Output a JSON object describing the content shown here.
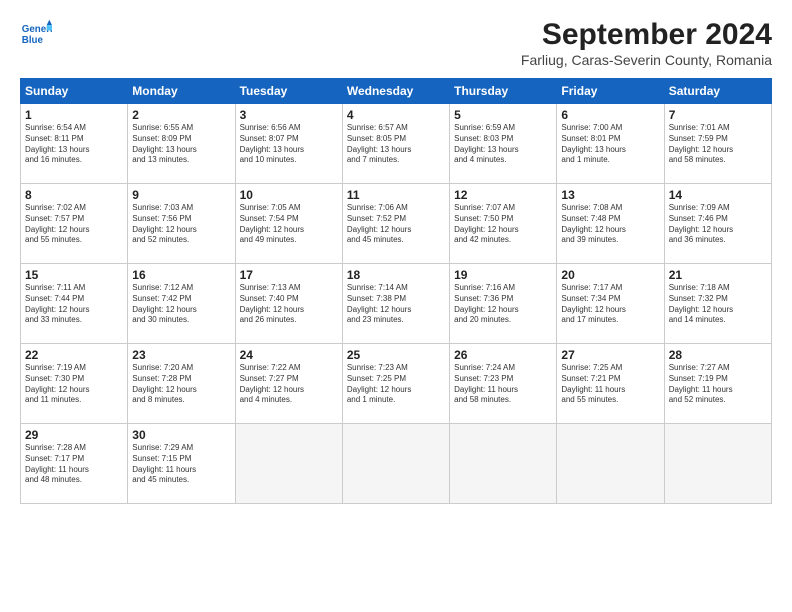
{
  "header": {
    "logo_line1": "General",
    "logo_line2": "Blue",
    "month": "September 2024",
    "location": "Farliug, Caras-Severin County, Romania"
  },
  "weekdays": [
    "Sunday",
    "Monday",
    "Tuesday",
    "Wednesday",
    "Thursday",
    "Friday",
    "Saturday"
  ],
  "weeks": [
    [
      {
        "day": "1",
        "info": "Sunrise: 6:54 AM\nSunset: 8:11 PM\nDaylight: 13 hours\nand 16 minutes."
      },
      {
        "day": "2",
        "info": "Sunrise: 6:55 AM\nSunset: 8:09 PM\nDaylight: 13 hours\nand 13 minutes."
      },
      {
        "day": "3",
        "info": "Sunrise: 6:56 AM\nSunset: 8:07 PM\nDaylight: 13 hours\nand 10 minutes."
      },
      {
        "day": "4",
        "info": "Sunrise: 6:57 AM\nSunset: 8:05 PM\nDaylight: 13 hours\nand 7 minutes."
      },
      {
        "day": "5",
        "info": "Sunrise: 6:59 AM\nSunset: 8:03 PM\nDaylight: 13 hours\nand 4 minutes."
      },
      {
        "day": "6",
        "info": "Sunrise: 7:00 AM\nSunset: 8:01 PM\nDaylight: 13 hours\nand 1 minute."
      },
      {
        "day": "7",
        "info": "Sunrise: 7:01 AM\nSunset: 7:59 PM\nDaylight: 12 hours\nand 58 minutes."
      }
    ],
    [
      {
        "day": "8",
        "info": "Sunrise: 7:02 AM\nSunset: 7:57 PM\nDaylight: 12 hours\nand 55 minutes."
      },
      {
        "day": "9",
        "info": "Sunrise: 7:03 AM\nSunset: 7:56 PM\nDaylight: 12 hours\nand 52 minutes."
      },
      {
        "day": "10",
        "info": "Sunrise: 7:05 AM\nSunset: 7:54 PM\nDaylight: 12 hours\nand 49 minutes."
      },
      {
        "day": "11",
        "info": "Sunrise: 7:06 AM\nSunset: 7:52 PM\nDaylight: 12 hours\nand 45 minutes."
      },
      {
        "day": "12",
        "info": "Sunrise: 7:07 AM\nSunset: 7:50 PM\nDaylight: 12 hours\nand 42 minutes."
      },
      {
        "day": "13",
        "info": "Sunrise: 7:08 AM\nSunset: 7:48 PM\nDaylight: 12 hours\nand 39 minutes."
      },
      {
        "day": "14",
        "info": "Sunrise: 7:09 AM\nSunset: 7:46 PM\nDaylight: 12 hours\nand 36 minutes."
      }
    ],
    [
      {
        "day": "15",
        "info": "Sunrise: 7:11 AM\nSunset: 7:44 PM\nDaylight: 12 hours\nand 33 minutes."
      },
      {
        "day": "16",
        "info": "Sunrise: 7:12 AM\nSunset: 7:42 PM\nDaylight: 12 hours\nand 30 minutes."
      },
      {
        "day": "17",
        "info": "Sunrise: 7:13 AM\nSunset: 7:40 PM\nDaylight: 12 hours\nand 26 minutes."
      },
      {
        "day": "18",
        "info": "Sunrise: 7:14 AM\nSunset: 7:38 PM\nDaylight: 12 hours\nand 23 minutes."
      },
      {
        "day": "19",
        "info": "Sunrise: 7:16 AM\nSunset: 7:36 PM\nDaylight: 12 hours\nand 20 minutes."
      },
      {
        "day": "20",
        "info": "Sunrise: 7:17 AM\nSunset: 7:34 PM\nDaylight: 12 hours\nand 17 minutes."
      },
      {
        "day": "21",
        "info": "Sunrise: 7:18 AM\nSunset: 7:32 PM\nDaylight: 12 hours\nand 14 minutes."
      }
    ],
    [
      {
        "day": "22",
        "info": "Sunrise: 7:19 AM\nSunset: 7:30 PM\nDaylight: 12 hours\nand 11 minutes."
      },
      {
        "day": "23",
        "info": "Sunrise: 7:20 AM\nSunset: 7:28 PM\nDaylight: 12 hours\nand 8 minutes."
      },
      {
        "day": "24",
        "info": "Sunrise: 7:22 AM\nSunset: 7:27 PM\nDaylight: 12 hours\nand 4 minutes."
      },
      {
        "day": "25",
        "info": "Sunrise: 7:23 AM\nSunset: 7:25 PM\nDaylight: 12 hours\nand 1 minute."
      },
      {
        "day": "26",
        "info": "Sunrise: 7:24 AM\nSunset: 7:23 PM\nDaylight: 11 hours\nand 58 minutes."
      },
      {
        "day": "27",
        "info": "Sunrise: 7:25 AM\nSunset: 7:21 PM\nDaylight: 11 hours\nand 55 minutes."
      },
      {
        "day": "28",
        "info": "Sunrise: 7:27 AM\nSunset: 7:19 PM\nDaylight: 11 hours\nand 52 minutes."
      }
    ],
    [
      {
        "day": "29",
        "info": "Sunrise: 7:28 AM\nSunset: 7:17 PM\nDaylight: 11 hours\nand 48 minutes."
      },
      {
        "day": "30",
        "info": "Sunrise: 7:29 AM\nSunset: 7:15 PM\nDaylight: 11 hours\nand 45 minutes."
      },
      {
        "day": "",
        "info": ""
      },
      {
        "day": "",
        "info": ""
      },
      {
        "day": "",
        "info": ""
      },
      {
        "day": "",
        "info": ""
      },
      {
        "day": "",
        "info": ""
      }
    ]
  ]
}
